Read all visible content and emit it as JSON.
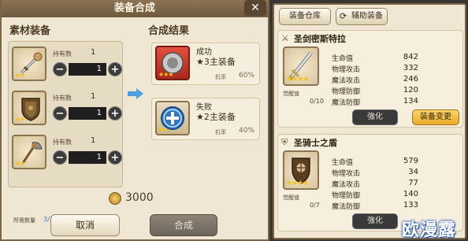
{
  "dialog": {
    "title": "装备合成",
    "close": "✕",
    "materials_heading": "素材装备",
    "result_heading": "合成结果",
    "owned_label": "持有数",
    "required_label": "所需数量",
    "required_value": "3/3",
    "materials": [
      {
        "owned": "1",
        "qty": "1",
        "stars": "★★",
        "icon": "sword-icon"
      },
      {
        "owned": "1",
        "qty": "1",
        "stars": "★★",
        "icon": "shield-icon"
      },
      {
        "owned": "1",
        "qty": "1",
        "stars": "★★",
        "icon": "axe-icon"
      }
    ],
    "results": [
      {
        "name": "成功",
        "sub": "★3主装备",
        "rate_label": "机率",
        "rate": "60%",
        "stars": "★★★"
      },
      {
        "name": "失败",
        "sub": "★2主装备",
        "rate_label": "机率",
        "rate": "40%",
        "stars": "★★"
      }
    ],
    "gold": "3000",
    "cancel": "取消",
    "confirm": "合成"
  },
  "right": {
    "tab_warehouse": "装备仓库",
    "tab_assist": "辅助装备",
    "awake_label": "觉醒值",
    "strengthen": "強化",
    "change": "装备变更",
    "equipment": [
      {
        "name": "圣剑密斯特拉",
        "stars": "★★★★",
        "awake": "0/10",
        "stats": [
          {
            "label": "生命值",
            "value": "842"
          },
          {
            "label": "物理攻击",
            "value": "332"
          },
          {
            "label": "魔法攻击",
            "value": "246"
          },
          {
            "label": "物理防御",
            "value": "120"
          },
          {
            "label": "魔法防御",
            "value": "134"
          }
        ]
      },
      {
        "name": "圣骑士之盾",
        "stars": "★★★★",
        "awake": "0/7",
        "stats": [
          {
            "label": "生命值",
            "value": "579"
          },
          {
            "label": "物理攻击",
            "value": "34"
          },
          {
            "label": "魔法攻击",
            "value": "77"
          },
          {
            "label": "物理防御",
            "value": "140"
          },
          {
            "label": "魔法防御",
            "value": "133"
          }
        ]
      }
    ]
  },
  "watermark": "欧漫露",
  "colors": {
    "accent_gold": "#e7a92a",
    "success_red": "#c0392b",
    "fail_blue": "#2f78c6"
  }
}
